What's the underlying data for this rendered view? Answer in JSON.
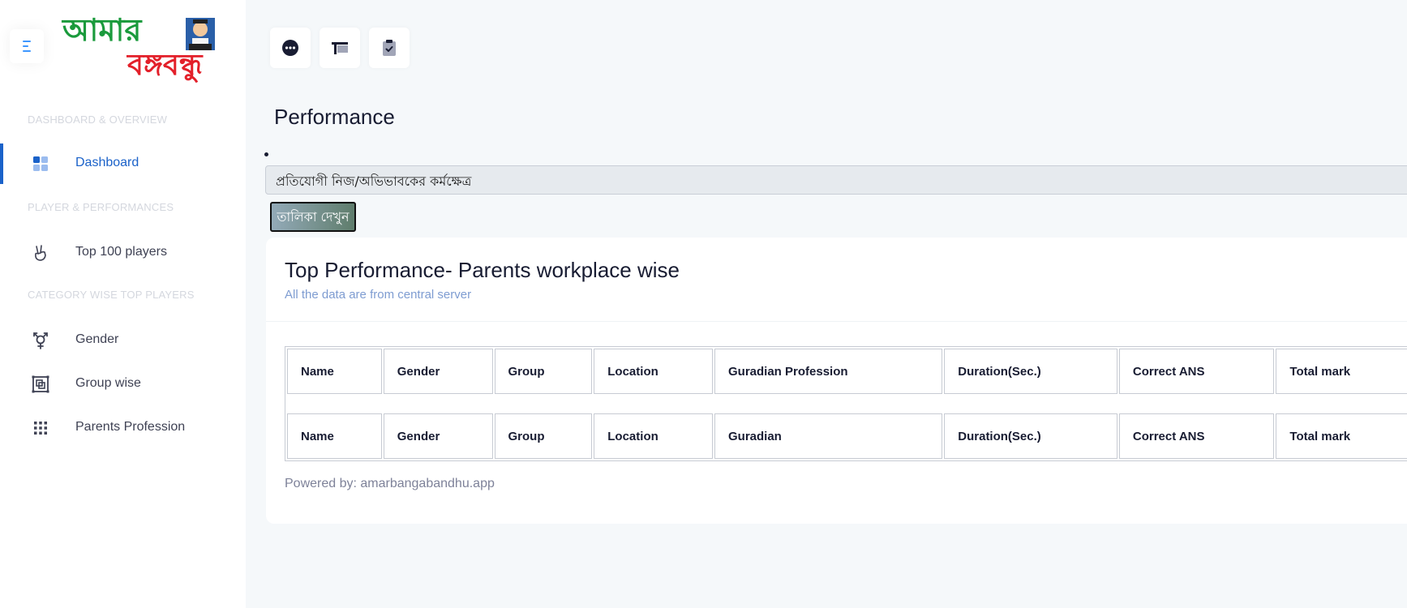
{
  "sidebar": {
    "logo_text_top": "আমার",
    "logo_text_bottom": "বঙ্গবন্ধু",
    "sections": [
      {
        "label": "DASHBOARD & OVERVIEW"
      },
      {
        "label": "PLAYER & PERFORMANCES"
      },
      {
        "label": "CATEGORY WISE TOP PLAYERS"
      }
    ],
    "items": [
      {
        "label": "Dashboard",
        "icon": "dashboard-grid-icon",
        "active": true
      },
      {
        "label": "Top 100 players",
        "icon": "hand-victory-icon"
      },
      {
        "label": "Gender",
        "icon": "gender-icon"
      },
      {
        "label": "Group wise",
        "icon": "group-square-icon"
      },
      {
        "label": "Parents Profession",
        "icon": "dots-grid-icon"
      }
    ]
  },
  "toolbar": {
    "buttons": [
      {
        "icon": "chat-dots-icon"
      },
      {
        "icon": "pin-flag-icon"
      },
      {
        "icon": "clipboard-check-icon"
      }
    ]
  },
  "main": {
    "page_title": "Performance",
    "select_value": "প্রতিযোগী নিজ/অভিভাবকের কর্মক্ষেত্র",
    "view_button": "তালিকা দেখুন",
    "card": {
      "title": "Top Performance- Parents workplace wise",
      "subtitle": "All the data are from central server",
      "header_row": [
        "Name",
        "Gender",
        "Group",
        "Location",
        "Guradian Profession",
        "Duration(Sec.)",
        "Correct ANS",
        "Total mark"
      ],
      "footer_row": [
        "Name",
        "Gender",
        "Group",
        "Location",
        "Guradian",
        "Duration(Sec.)",
        "Correct ANS",
        "Total mark"
      ],
      "powered_by": "Powered by: amarbangabandhu.app"
    }
  },
  "colors": {
    "accent": "#1b62c9",
    "background": "#f5f8fa",
    "logo_green": "#1a9a3c",
    "logo_red": "#e3202a"
  }
}
